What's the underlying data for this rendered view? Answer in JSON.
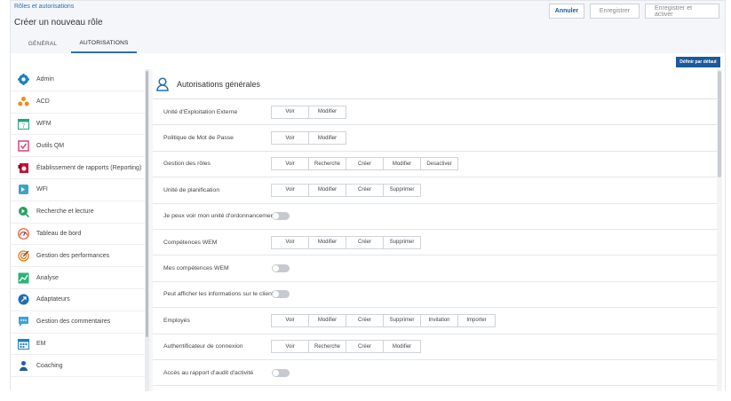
{
  "header": {
    "breadcrumb": "Rôles et autorisations",
    "title": "Créer un nouveau rôle",
    "buttons": {
      "cancel": "Annuler",
      "save": "Enregistrer",
      "save_activate": "Enregistrer et activer"
    }
  },
  "tabs": [
    {
      "label": "GÉNÉRAL"
    },
    {
      "label": "AUTORISATIONS",
      "active": true
    }
  ],
  "default_button": "Définir par défaut",
  "sidebar": {
    "items": [
      {
        "label": "Admin",
        "icon": "gear-icon"
      },
      {
        "label": "ACD",
        "icon": "acd-icon"
      },
      {
        "label": "WFM",
        "icon": "calendar-7-icon"
      },
      {
        "label": "Outils QM",
        "icon": "checkbox-icon"
      },
      {
        "label": "Établissement de rapports (Reporting)",
        "icon": "report-icon"
      },
      {
        "label": "WFI",
        "icon": "wfi-icon"
      },
      {
        "label": "Recherche et lecture",
        "icon": "search-play-icon"
      },
      {
        "label": "Tableau de bord",
        "icon": "dashboard-icon"
      },
      {
        "label": "Gestion des performances",
        "icon": "target-icon"
      },
      {
        "label": "Analyse",
        "icon": "analytics-icon"
      },
      {
        "label": "Adaptateurs",
        "icon": "adapter-icon"
      },
      {
        "label": "Gestion des commentaires",
        "icon": "comment-icon"
      },
      {
        "label": "EM",
        "icon": "em-calendar-icon"
      },
      {
        "label": "Coaching",
        "icon": "coaching-icon"
      }
    ]
  },
  "main": {
    "title": "Autorisations générales",
    "rows": [
      {
        "label": "Unité d'Exploitation Externe",
        "buttons": [
          "Voir",
          "Modifier"
        ]
      },
      {
        "label": "Politique de Mot de Passe",
        "buttons": [
          "Voir",
          "Modifier"
        ]
      },
      {
        "label": "Gestion des rôles",
        "buttons": [
          "Voir",
          "Recherche",
          "Créer",
          "Modifier",
          "Desactiver"
        ]
      },
      {
        "label": "Unité de planification",
        "buttons": [
          "Voir",
          "Modifier",
          "Créer",
          "Supprimer"
        ]
      },
      {
        "label": "Je peux voir mon unité d'ordonnancement",
        "toggle": true
      },
      {
        "label": "Compétences WEM",
        "buttons": [
          "Voir",
          "Modifier",
          "Créer",
          "Supprimer"
        ]
      },
      {
        "label": "Mes compétences WEM",
        "toggle": true
      },
      {
        "label": "Peut afficher les informations sur le client",
        "toggle": true
      },
      {
        "label": "Employés",
        "buttons": [
          "Voir",
          "Modifier",
          "Créer",
          "Supprimer",
          "Invitation",
          "Importer"
        ]
      },
      {
        "label": "Authentificateur de connexion",
        "buttons": [
          "Voir",
          "Recherche",
          "Créer",
          "Modifier"
        ]
      },
      {
        "label": "Accès au rapport d'audit d'activité",
        "toggle": true
      }
    ]
  },
  "colors": {
    "accent": "#1a5a9a",
    "link": "#2a6fb0"
  }
}
